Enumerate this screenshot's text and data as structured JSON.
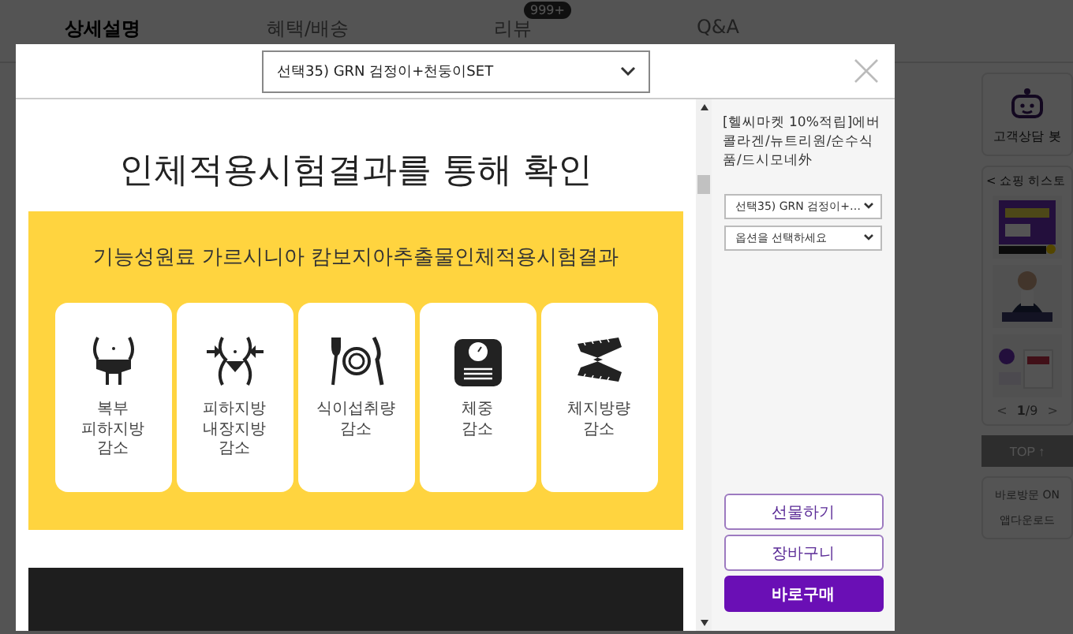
{
  "page": {
    "tabs": [
      {
        "label": "상세설명",
        "selected": true
      },
      {
        "label": "혜택/배송",
        "selected": false
      },
      {
        "label": "리뷰",
        "selected": false,
        "badge": "999+"
      },
      {
        "label": "Q&A",
        "selected": false
      }
    ],
    "sidebar": {
      "chatbot_label": "고객상담 봇",
      "history_prev": "<",
      "history_title": "쇼핑 히스토",
      "history_items": [
        {
          "kind": "picture"
        },
        {
          "kind": "picture"
        },
        {
          "kind": "picture"
        }
      ],
      "pager": {
        "prev": "<",
        "text": "**1**/9",
        "next": ">"
      },
      "top_button": "TOP ↑",
      "links": [
        "바로방문 ON",
        "앱다운로드"
      ]
    }
  },
  "modal": {
    "option_select": "선택35) GRN 검정이+천둥이SET",
    "heading": "인체적용시험결과를 통해 확인",
    "banner_title": "기능성원료 가르시니아 캄보지아추출물인체적용시험결과",
    "benefits": [
      {
        "kind": "waist",
        "lines": [
          "복부",
          "피하지방",
          "감소"
        ]
      },
      {
        "kind": "waist-arrows",
        "lines": [
          "피하지방",
          "내장지방",
          "감소"
        ]
      },
      {
        "kind": "tableware",
        "lines": [
          "식이섭취량",
          "감소"
        ]
      },
      {
        "kind": "scale",
        "lines": [
          "체중",
          "감소"
        ]
      },
      {
        "kind": "tape",
        "lines": [
          "체지방량",
          "감소"
        ]
      }
    ],
    "side": {
      "product_title": "[헬씨마켓 10%적립]에버콜라겐/뉴트리원/순수식품/드시모네外",
      "selects": [
        "선택35) GRN 검정이+…",
        "옵션을 선택하세요"
      ],
      "buttons": [
        {
          "label": "선물하기",
          "kind": "outline"
        },
        {
          "label": "장바구니",
          "kind": "outline"
        },
        {
          "label": "바로구매",
          "kind": "primary"
        }
      ]
    }
  }
}
